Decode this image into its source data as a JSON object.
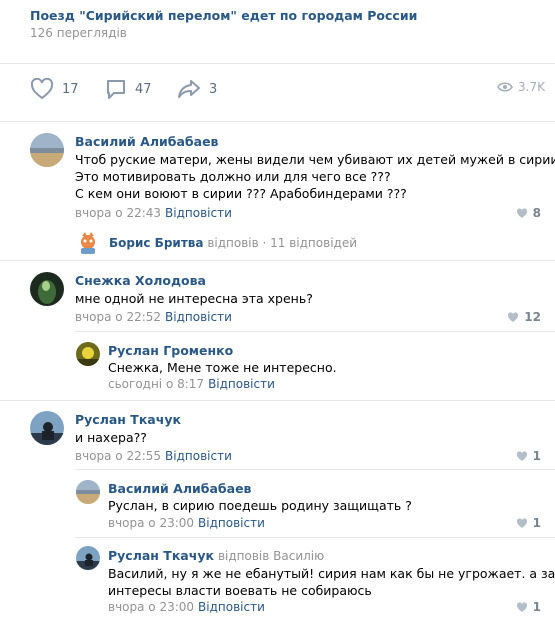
{
  "post": {
    "title": "Поезд \"Сирийский перелом\" едет по городам России",
    "views_text": "126 переглядів"
  },
  "actions": {
    "likes": "17",
    "comments": "47",
    "shares": "3",
    "views": "3.7K"
  },
  "comments": [
    {
      "author": "Василий Алибабаев",
      "lines": [
        "Чтоб руские матери, жены видели чем убивают их детей мужей в сирии ???",
        "Это мотивировать должно или для чего все ???",
        "С кем они воюют в сирии ??? Арабобиндерами ???"
      ],
      "time": "вчора о 22:43",
      "reply": "Відповісти",
      "likes": "8",
      "thread": {
        "author": "Борис Бритва",
        "replied": "відповів",
        "count": "· 11 відповідей"
      }
    },
    {
      "author": "Снежка Холодова",
      "lines": [
        "мне одной не интересна эта хрень?"
      ],
      "time": "вчора о 22:52",
      "reply": "Відповісти",
      "likes": "12",
      "replies": [
        {
          "author": "Руслан Громенко",
          "text": "Снежка, Мене тоже не интересно.",
          "time": "сьогодні о 8:17",
          "reply": "Відповісти"
        }
      ]
    },
    {
      "author": "Руслан Ткачук",
      "lines": [
        "и нахера??"
      ],
      "time": "вчора о 22:55",
      "reply": "Відповісти",
      "likes": "1",
      "replies": [
        {
          "author": "Василий Алибабаев",
          "text": "Руслан, в сирию поедешь родину защищать ?",
          "time": "вчора о 23:00",
          "reply": "Відповісти",
          "likes": "1"
        },
        {
          "author": "Руслан Ткачук",
          "replied_to": "відповів Василію",
          "lines": [
            "Василий, ну я же не ебанутый! сирия нам как бы не угрожает. а за",
            "интересы власти воевать не собираюсь"
          ],
          "time": "вчора о 23:00",
          "reply": "Відповісти",
          "likes": "1"
        }
      ]
    }
  ],
  "colors": {
    "link": "#2a5885",
    "muted": "#939393",
    "divider": "#e7e8ec"
  }
}
